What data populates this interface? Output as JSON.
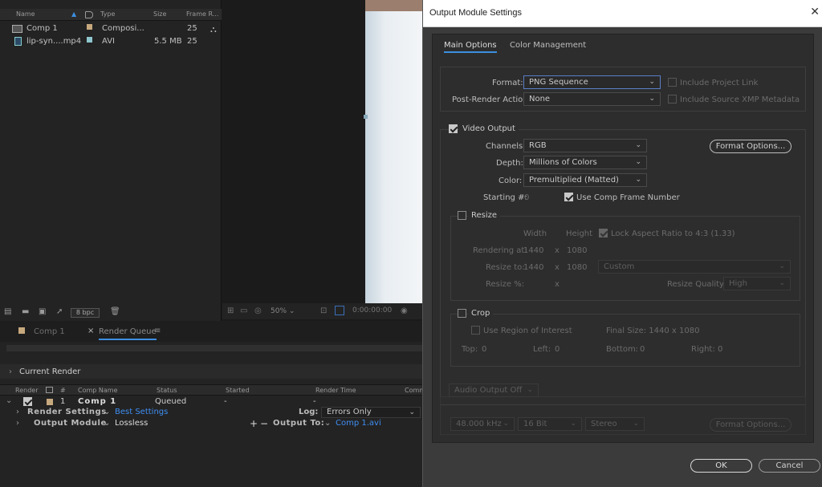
{
  "project": {
    "columns": {
      "name": "Name",
      "type": "Type",
      "size": "Size",
      "frame_rate": "Frame R..."
    },
    "items": [
      {
        "name": "Comp 1",
        "type": "Composi...",
        "size": "",
        "fps": "25",
        "color": "#c7a97e"
      },
      {
        "name": "lip-syn....mp4",
        "type": "AVI",
        "size": "5.5 MB",
        "fps": "25",
        "color": "#8fc7cf"
      }
    ],
    "bpc": "8 bpc"
  },
  "viewer": {
    "zoom": "50%",
    "timecode": "0:00:00:00"
  },
  "render_queue": {
    "tabs": [
      {
        "label": "Comp 1"
      },
      {
        "label": "Render Queue"
      }
    ],
    "current_render": "Current Render",
    "columns": {
      "render": "Render",
      "num": "#",
      "comp_name": "Comp Name",
      "status": "Status",
      "started": "Started",
      "render_time": "Render Time",
      "comment": "Comm"
    },
    "item": {
      "num": "1",
      "comp": "Comp 1",
      "status": "Queued",
      "started": "-",
      "render_time": "-"
    },
    "render_settings_label": "Render Settings",
    "render_settings_value": "Best Settings",
    "log_label": "Log:",
    "log_value": "Errors Only",
    "output_module_label": "Output Module",
    "output_module_value": "Lossless",
    "output_to_label": "Output To:",
    "output_to_value": "Comp 1.avi"
  },
  "dialog": {
    "title": "Output Module Settings",
    "tabs": [
      "Main Options",
      "Color Management"
    ],
    "format_label": "Format:",
    "format_value": "PNG Sequence",
    "include_project_link": "Include Project Link",
    "post_render_label": "Post-Render Action:",
    "post_render_value": "None",
    "include_xmp": "Include Source XMP Metadata",
    "video_output": "Video Output",
    "channels_label": "Channels:",
    "channels_value": "RGB",
    "format_options": "Format Options...",
    "depth_label": "Depth:",
    "depth_value": "Millions of Colors",
    "color_label": "Color:",
    "color_value": "Premultiplied (Matted)",
    "starting_label": "Starting #:",
    "starting_value": "0",
    "use_comp_frame": "Use Comp Frame Number",
    "resize": {
      "label": "Resize",
      "width": "Width",
      "height": "Height",
      "lock_aspect": "Lock Aspect Ratio to 4:3 (1.33)",
      "rendering_at": "Rendering at:",
      "rendering_w": "1440",
      "rendering_h": "1080",
      "resize_to": "Resize to:",
      "resize_w": "1440",
      "resize_h": "1080",
      "custom": "Custom",
      "resize_pct": "Resize %:",
      "quality_label": "Resize Quality:",
      "quality_value": "High",
      "x": "x"
    },
    "crop": {
      "label": "Crop",
      "use_roi": "Use Region of Interest",
      "final_size": "Final Size: 1440 x 1080",
      "top": "Top:",
      "top_v": "0",
      "left": "Left:",
      "left_v": "0",
      "bottom": "Bottom:",
      "bottom_v": "0",
      "right": "Right:",
      "right_v": "0"
    },
    "audio": {
      "output": "Audio Output Off",
      "rate": "48.000 kHz",
      "bits": "16 Bit",
      "channels": "Stereo",
      "format_options": "Format Options..."
    },
    "ok": "OK",
    "cancel": "Cancel"
  }
}
